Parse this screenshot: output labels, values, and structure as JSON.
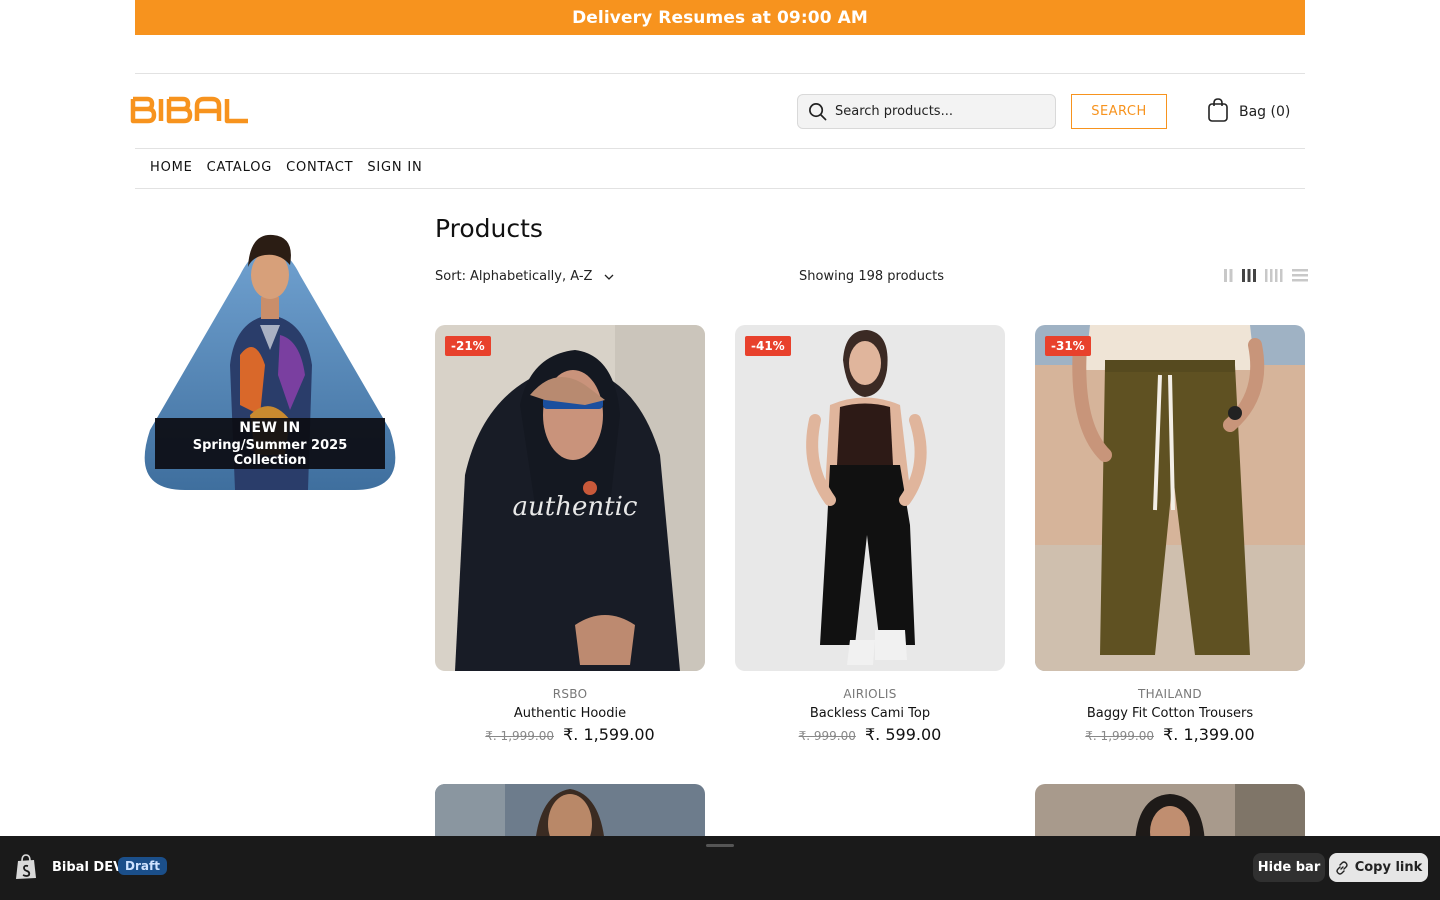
{
  "announcement": "Delivery Resumes at 09:00 AM",
  "brand": {
    "logo_text": "BIBAL",
    "accent": "#f7931e"
  },
  "header": {
    "search_placeholder": "Search products...",
    "search_button": "SEARCH",
    "bag_label": "Bag (0)"
  },
  "nav": [
    "HOME",
    "CATALOG",
    "CONTACT",
    "SIGN IN"
  ],
  "promo": {
    "line1": "NEW IN",
    "line2": "Spring/Summer 2025 Collection"
  },
  "collection": {
    "title": "Products",
    "sort_label": "Sort:",
    "sort_value": "Alphabetically, A-Z",
    "count": "Showing 198 products"
  },
  "products": [
    {
      "badge": "-21%",
      "vendor": "RSBO",
      "name": "Authentic Hoodie",
      "old_price": "₹. 1,999.00",
      "price": "₹. 1,599.00"
    },
    {
      "badge": "-41%",
      "vendor": "AIRIOLIS",
      "name": "Backless Cami Top",
      "old_price": "₹. 999.00",
      "price": "₹. 599.00"
    },
    {
      "badge": "-31%",
      "vendor": "THAILAND",
      "name": "Baggy Fit Cotton Trousers",
      "old_price": "₹. 1,999.00",
      "price": "₹. 1,399.00"
    }
  ],
  "admin_bar": {
    "store": "Bibal DEV",
    "status": "Draft",
    "hide": "Hide bar",
    "copy": "Copy link"
  }
}
